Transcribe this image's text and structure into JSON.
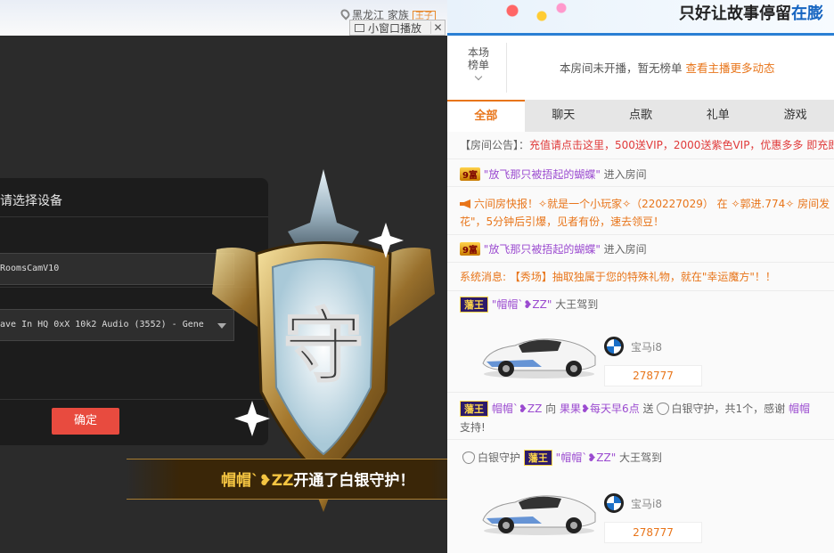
{
  "topbar": {
    "location": "黑龙江",
    "family_label": "家族",
    "family_tag": "王子",
    "slogan_prefix": "只好让故事停留",
    "slogan_highlight": "在膨"
  },
  "mini_window": {
    "label": "小窗口播放",
    "close": "✕"
  },
  "dialog": {
    "title": "请选择设备",
    "camera": "RoomsCamV10",
    "audio": "ave In HQ 0xX 10k2 Audio (3552) - Gene",
    "confirm": "确定"
  },
  "badge": {
    "glyph": "守"
  },
  "notice": {
    "user": "帽帽ˋ❥ZZ",
    "text": "开通了白银守护！"
  },
  "rank": {
    "label_line1": "本场",
    "label_line2": "榜单",
    "message": "本房间未开播，暂无榜单",
    "link": "查看主播更多动态"
  },
  "tabs": [
    "全部",
    "聊天",
    "点歌",
    "礼单",
    "游戏"
  ],
  "chat": {
    "announcement_label": "【房间公告】：",
    "announcement_text": "充值请点击这里，500送VIP，2000送紫色VIP，优惠多多 即充即",
    "entry1_level": "9富",
    "entry1_user": "\"放飞那只被捂起的蝴蝶\"",
    "entry1_action": "进入房间",
    "news_label": "六间房快报！",
    "news_line1": "✧就是一个小玩家✧（220227029） 在 ✧郭进.774✧ 房间发",
    "news_line2": "花\"，5分钟后引爆，见者有份，速去领豆！",
    "entry2_level": "9富",
    "entry2_user": "\"放飞那只被捂起的蝴蝶\"",
    "entry2_action": "进入房间",
    "system_label": "系统消息:",
    "system_text": "【秀场】抽取独属于您的特殊礼物，就在\"幸运魔方\"！！",
    "arrive1_fan": "藩王",
    "arrive1_user": "\"帽帽ˋ❥ZZ\"",
    "arrive1_action": "大王驾到",
    "car1_name": "宝马i8",
    "car1_price": "278777",
    "gift_fan": "藩王",
    "gift_user": "帽帽ˋ❥ZZ",
    "gift_to": "向",
    "gift_target": "果果❥每天早6点",
    "gift_send": "送",
    "gift_item": "白银守护，共1个，感谢",
    "gift_thanks_user": "帽帽",
    "gift_line2": "支持!",
    "arrive2_prefix": "白银守护",
    "arrive2_fan": "藩王",
    "arrive2_user": "\"帽帽ˋ❥ZZ\"",
    "arrive2_action": "大王驾到",
    "car2_name": "宝马i8",
    "car2_price": "278777"
  }
}
